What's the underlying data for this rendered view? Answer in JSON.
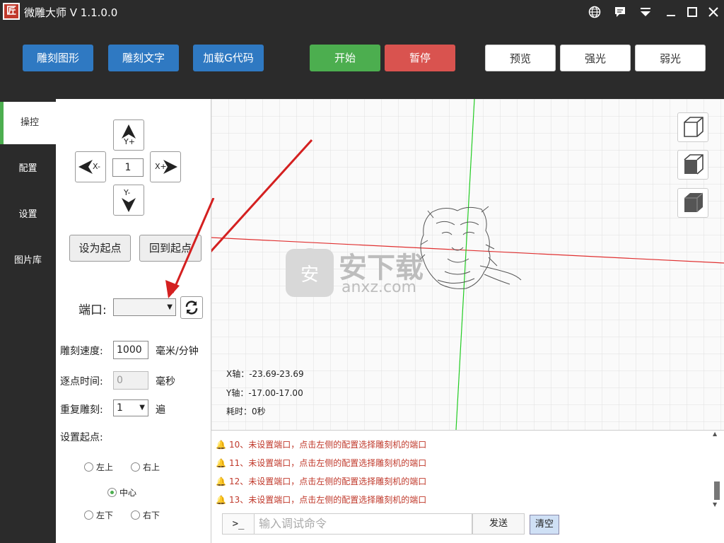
{
  "window": {
    "logo": "匠",
    "title": "微雕大师 V 1.1.0.0",
    "controls": {
      "globe": "🌐",
      "message": "▀",
      "menu": "▼",
      "minimize": "—",
      "maximize": "☐",
      "close": "✕"
    }
  },
  "toolbar": {
    "engrave_image": "雕刻图形",
    "engrave_text": "雕刻文字",
    "load_gcode": "加载G代码",
    "start": "开始",
    "pause": "暂停",
    "preview": "预览",
    "strong_light": "强光",
    "weak_light": "弱光"
  },
  "tabs": [
    {
      "label": "操控",
      "active": true
    },
    {
      "label": "配置",
      "active": false
    },
    {
      "label": "设置",
      "active": false
    },
    {
      "label": "图片库",
      "active": false
    }
  ],
  "jog": {
    "y_plus": "Y+",
    "y_minus": "Y-",
    "x_minus": "X-",
    "x_plus": "X+",
    "step": "1"
  },
  "origin": {
    "set_origin": "设为起点",
    "go_origin": "回到起点"
  },
  "port": {
    "label": "端口:",
    "value": "",
    "refresh_icon": "⟳"
  },
  "settings": {
    "speed_label": "雕刻速度:",
    "speed_value": "1000",
    "speed_unit": "毫米/分钟",
    "dot_label": "逐点时间:",
    "dot_value": "0",
    "dot_unit": "毫秒",
    "repeat_label": "重复雕刻:",
    "repeat_value": "1",
    "repeat_unit": "遍",
    "origin_label": "设置起点:",
    "origin_options": {
      "top_left": "左上",
      "top_right": "右上",
      "center": "中心",
      "bottom_left": "左下",
      "bottom_right": "右下"
    },
    "origin_selected": "center"
  },
  "canvas": {
    "x_axis": "X轴：-23.69-23.69",
    "y_axis": "Y轴：-17.00-17.00",
    "time": "耗时：0秒",
    "watermark": "安下载",
    "watermark_sub": "anxz.com"
  },
  "log": {
    "lines": [
      "10、未设置端口，点击左侧的配置选择雕刻机的端口",
      "11、未设置端口，点击左侧的配置选择雕刻机的端口",
      "12、未设置端口，点击左侧的配置选择雕刻机的端口",
      "13、未设置端口，点击左侧的配置选择雕刻机的端口"
    ]
  },
  "console": {
    "prompt": ">_",
    "placeholder": "输入调试命令",
    "send": "发送",
    "clear": "清空"
  },
  "colors": {
    "blue": "#2f79c2",
    "green": "#4cae4f",
    "red": "#d9534f",
    "log_red": "#c0392b"
  }
}
